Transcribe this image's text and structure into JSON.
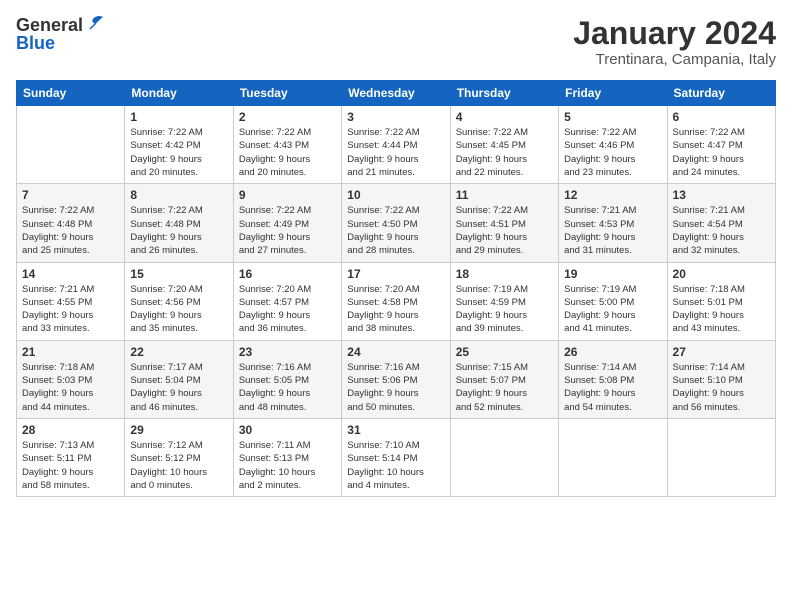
{
  "header": {
    "logo_general": "General",
    "logo_blue": "Blue",
    "month_title": "January 2024",
    "location": "Trentinara, Campania, Italy"
  },
  "days_of_week": [
    "Sunday",
    "Monday",
    "Tuesday",
    "Wednesday",
    "Thursday",
    "Friday",
    "Saturday"
  ],
  "weeks": [
    [
      {
        "day": "",
        "info": ""
      },
      {
        "day": "1",
        "info": "Sunrise: 7:22 AM\nSunset: 4:42 PM\nDaylight: 9 hours\nand 20 minutes."
      },
      {
        "day": "2",
        "info": "Sunrise: 7:22 AM\nSunset: 4:43 PM\nDaylight: 9 hours\nand 20 minutes."
      },
      {
        "day": "3",
        "info": "Sunrise: 7:22 AM\nSunset: 4:44 PM\nDaylight: 9 hours\nand 21 minutes."
      },
      {
        "day": "4",
        "info": "Sunrise: 7:22 AM\nSunset: 4:45 PM\nDaylight: 9 hours\nand 22 minutes."
      },
      {
        "day": "5",
        "info": "Sunrise: 7:22 AM\nSunset: 4:46 PM\nDaylight: 9 hours\nand 23 minutes."
      },
      {
        "day": "6",
        "info": "Sunrise: 7:22 AM\nSunset: 4:47 PM\nDaylight: 9 hours\nand 24 minutes."
      }
    ],
    [
      {
        "day": "7",
        "info": "Sunrise: 7:22 AM\nSunset: 4:48 PM\nDaylight: 9 hours\nand 25 minutes."
      },
      {
        "day": "8",
        "info": "Sunrise: 7:22 AM\nSunset: 4:48 PM\nDaylight: 9 hours\nand 26 minutes."
      },
      {
        "day": "9",
        "info": "Sunrise: 7:22 AM\nSunset: 4:49 PM\nDaylight: 9 hours\nand 27 minutes."
      },
      {
        "day": "10",
        "info": "Sunrise: 7:22 AM\nSunset: 4:50 PM\nDaylight: 9 hours\nand 28 minutes."
      },
      {
        "day": "11",
        "info": "Sunrise: 7:22 AM\nSunset: 4:51 PM\nDaylight: 9 hours\nand 29 minutes."
      },
      {
        "day": "12",
        "info": "Sunrise: 7:21 AM\nSunset: 4:53 PM\nDaylight: 9 hours\nand 31 minutes."
      },
      {
        "day": "13",
        "info": "Sunrise: 7:21 AM\nSunset: 4:54 PM\nDaylight: 9 hours\nand 32 minutes."
      }
    ],
    [
      {
        "day": "14",
        "info": "Sunrise: 7:21 AM\nSunset: 4:55 PM\nDaylight: 9 hours\nand 33 minutes."
      },
      {
        "day": "15",
        "info": "Sunrise: 7:20 AM\nSunset: 4:56 PM\nDaylight: 9 hours\nand 35 minutes."
      },
      {
        "day": "16",
        "info": "Sunrise: 7:20 AM\nSunset: 4:57 PM\nDaylight: 9 hours\nand 36 minutes."
      },
      {
        "day": "17",
        "info": "Sunrise: 7:20 AM\nSunset: 4:58 PM\nDaylight: 9 hours\nand 38 minutes."
      },
      {
        "day": "18",
        "info": "Sunrise: 7:19 AM\nSunset: 4:59 PM\nDaylight: 9 hours\nand 39 minutes."
      },
      {
        "day": "19",
        "info": "Sunrise: 7:19 AM\nSunset: 5:00 PM\nDaylight: 9 hours\nand 41 minutes."
      },
      {
        "day": "20",
        "info": "Sunrise: 7:18 AM\nSunset: 5:01 PM\nDaylight: 9 hours\nand 43 minutes."
      }
    ],
    [
      {
        "day": "21",
        "info": "Sunrise: 7:18 AM\nSunset: 5:03 PM\nDaylight: 9 hours\nand 44 minutes."
      },
      {
        "day": "22",
        "info": "Sunrise: 7:17 AM\nSunset: 5:04 PM\nDaylight: 9 hours\nand 46 minutes."
      },
      {
        "day": "23",
        "info": "Sunrise: 7:16 AM\nSunset: 5:05 PM\nDaylight: 9 hours\nand 48 minutes."
      },
      {
        "day": "24",
        "info": "Sunrise: 7:16 AM\nSunset: 5:06 PM\nDaylight: 9 hours\nand 50 minutes."
      },
      {
        "day": "25",
        "info": "Sunrise: 7:15 AM\nSunset: 5:07 PM\nDaylight: 9 hours\nand 52 minutes."
      },
      {
        "day": "26",
        "info": "Sunrise: 7:14 AM\nSunset: 5:08 PM\nDaylight: 9 hours\nand 54 minutes."
      },
      {
        "day": "27",
        "info": "Sunrise: 7:14 AM\nSunset: 5:10 PM\nDaylight: 9 hours\nand 56 minutes."
      }
    ],
    [
      {
        "day": "28",
        "info": "Sunrise: 7:13 AM\nSunset: 5:11 PM\nDaylight: 9 hours\nand 58 minutes."
      },
      {
        "day": "29",
        "info": "Sunrise: 7:12 AM\nSunset: 5:12 PM\nDaylight: 10 hours\nand 0 minutes."
      },
      {
        "day": "30",
        "info": "Sunrise: 7:11 AM\nSunset: 5:13 PM\nDaylight: 10 hours\nand 2 minutes."
      },
      {
        "day": "31",
        "info": "Sunrise: 7:10 AM\nSunset: 5:14 PM\nDaylight: 10 hours\nand 4 minutes."
      },
      {
        "day": "",
        "info": ""
      },
      {
        "day": "",
        "info": ""
      },
      {
        "day": "",
        "info": ""
      }
    ]
  ]
}
